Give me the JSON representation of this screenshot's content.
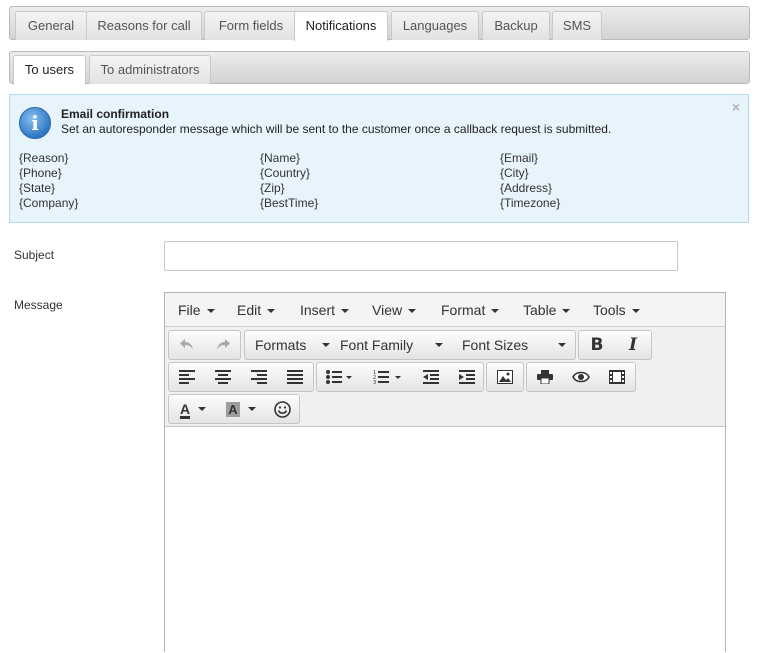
{
  "main_tabs": [
    "General",
    "Reasons for call",
    "Form fields",
    "Notifications",
    "Languages",
    "Backup",
    "SMS"
  ],
  "sub_tabs": [
    "To users",
    "To administrators"
  ],
  "info": {
    "title": "Email confirmation",
    "description": "Set an autoresponder message which will be sent to the customer once a callback request is submitted.",
    "close": "×",
    "placeholders": [
      [
        "{Reason}",
        "{Phone}",
        "{State}",
        "{Company}"
      ],
      [
        "{Name}",
        "{Country}",
        "{Zip}",
        "{BestTime}"
      ],
      [
        "{Email}",
        "{City}",
        "{Address}",
        "{Timezone}"
      ]
    ]
  },
  "form": {
    "subject_label": "Subject",
    "subject_value": "",
    "message_label": "Message"
  },
  "editor": {
    "menus": [
      "File",
      "Edit",
      "Insert",
      "View",
      "Format",
      "Table",
      "Tools"
    ],
    "dropdowns": [
      "Formats",
      "Font Family",
      "Font Sizes"
    ],
    "bold": "B",
    "italic": "I",
    "text_color": "A",
    "bg_color": "A",
    "body": ""
  },
  "icons": {
    "info": "i",
    "undo": "undo-icon",
    "redo": "redo-icon",
    "align_left": "align-left-icon",
    "align_center": "align-center-icon",
    "align_right": "align-right-icon",
    "justify": "align-justify-icon",
    "bullet_list": "bullet-list-icon",
    "numbered_list": "numbered-list-icon",
    "outdent": "outdent-icon",
    "indent": "indent-icon",
    "image": "image-icon",
    "print": "print-icon",
    "preview": "preview-icon",
    "media": "media-icon",
    "emoticons": "smiley-icon"
  },
  "colors": {
    "info_bg": "#e8f4fb",
    "info_border": "#b5d9ec",
    "tab_bar": "#d3d3d3"
  }
}
